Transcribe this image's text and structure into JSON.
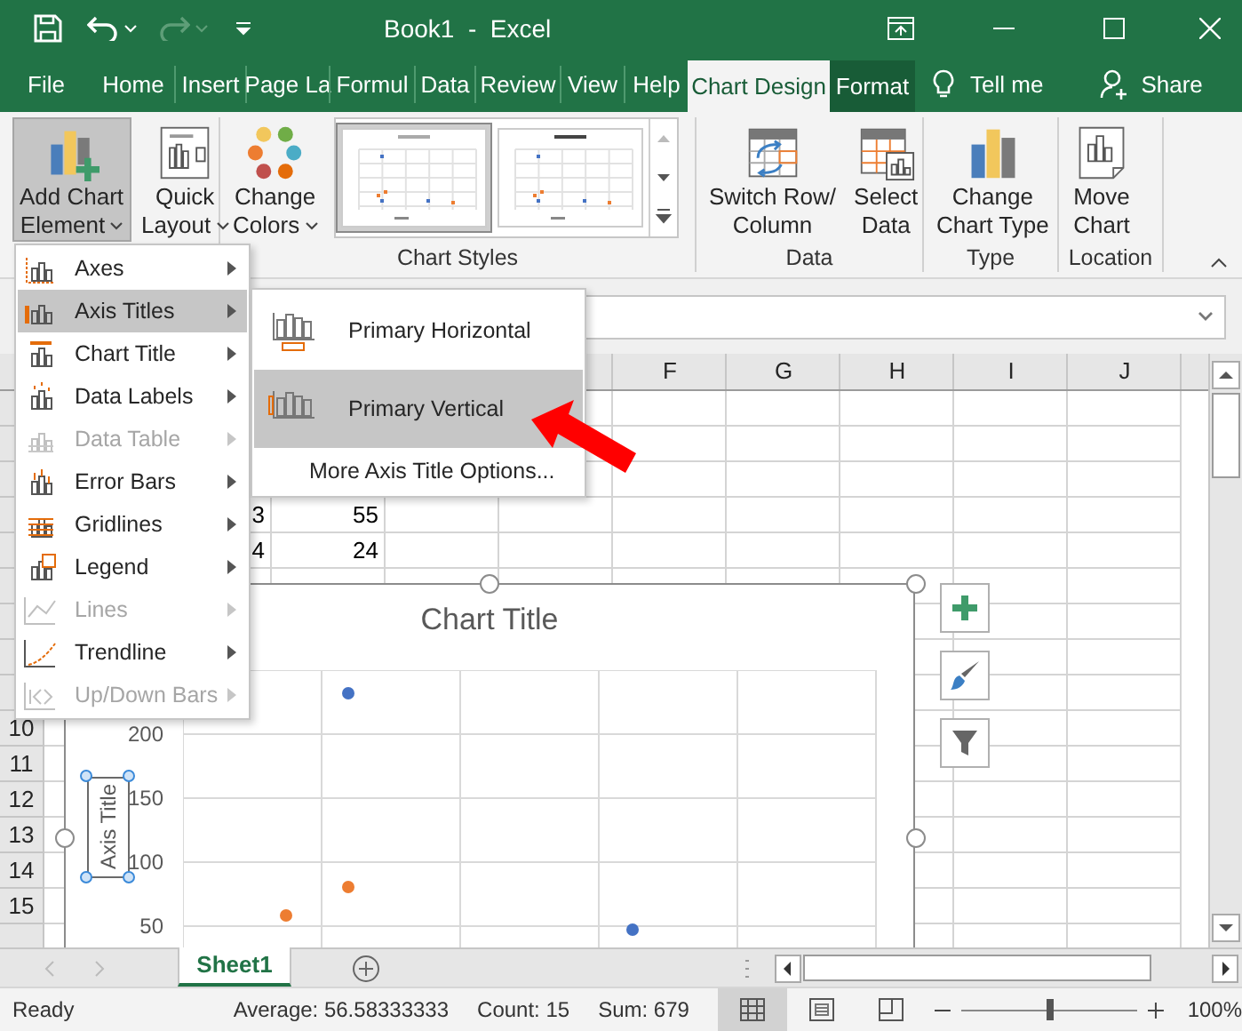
{
  "window": {
    "title": "Book1  -  Excel"
  },
  "ribbon_tabs": [
    {
      "label": "File",
      "selected": false,
      "contextual": false
    },
    {
      "label": "Home",
      "selected": false,
      "contextual": false
    },
    {
      "label": "Insert",
      "selected": false,
      "contextual": false
    },
    {
      "label": "Page La",
      "selected": false,
      "contextual": false
    },
    {
      "label": "Formul",
      "selected": false,
      "contextual": false
    },
    {
      "label": "Data",
      "selected": false,
      "contextual": false
    },
    {
      "label": "Review",
      "selected": false,
      "contextual": false
    },
    {
      "label": "View",
      "selected": false,
      "contextual": false
    },
    {
      "label": "Help",
      "selected": false,
      "contextual": false
    },
    {
      "label": "Chart Design",
      "selected": true,
      "contextual": true
    },
    {
      "label": "Format",
      "selected": false,
      "contextual": true
    }
  ],
  "tell_me": "Tell me",
  "share": "Share",
  "ribbon_groups": [
    {
      "kind": "layouts",
      "buttons": [
        {
          "lines": [
            "Add Chart",
            "Element"
          ],
          "dropdown": true,
          "pressed": true
        },
        {
          "lines": [
            "Quick",
            "Layout"
          ],
          "dropdown": true,
          "pressed": false
        }
      ]
    },
    {
      "kind": "styles",
      "label": "Chart Styles",
      "buttons": [
        {
          "lines": [
            "Change",
            "Colors"
          ],
          "dropdown": true,
          "pressed": false
        }
      ],
      "styles": [
        {
          "selected": true
        },
        {
          "selected": false
        }
      ]
    },
    {
      "kind": "plain",
      "label": "Data",
      "buttons": [
        {
          "lines": [
            "Switch Row/",
            "Column"
          ],
          "dropdown": false,
          "pressed": false
        },
        {
          "lines": [
            "Select",
            "Data"
          ],
          "dropdown": false,
          "pressed": false
        }
      ]
    },
    {
      "kind": "plain",
      "label": "Type",
      "buttons": [
        {
          "lines": [
            "Change",
            "Chart Type"
          ],
          "dropdown": false,
          "pressed": false
        }
      ]
    },
    {
      "kind": "plain",
      "label": "Location",
      "buttons": [
        {
          "lines": [
            "Move",
            "Chart"
          ],
          "dropdown": false,
          "pressed": false
        }
      ]
    }
  ],
  "chart_element_menu": [
    {
      "label": "Axes",
      "selected": false,
      "disabled": false
    },
    {
      "label": "Axis Titles",
      "selected": true,
      "disabled": false
    },
    {
      "label": "Chart Title",
      "selected": false,
      "disabled": false
    },
    {
      "label": "Data Labels",
      "selected": false,
      "disabled": false
    },
    {
      "label": "Data Table",
      "selected": false,
      "disabled": true
    },
    {
      "label": "Error Bars",
      "selected": false,
      "disabled": false
    },
    {
      "label": "Gridlines",
      "selected": false,
      "disabled": false
    },
    {
      "label": "Legend",
      "selected": false,
      "disabled": false
    },
    {
      "label": "Lines",
      "selected": false,
      "disabled": true
    },
    {
      "label": "Trendline",
      "selected": false,
      "disabled": false
    },
    {
      "label": "Up/Down Bars",
      "selected": false,
      "disabled": true
    }
  ],
  "axis_titles_submenu": [
    {
      "kind": "horizontal",
      "label": "Primary Horizontal",
      "selected": false
    },
    {
      "kind": "vertical",
      "label": "Primary Vertical",
      "selected": true
    },
    {
      "kind": "link",
      "label": "More Axis Title Options...",
      "selected": false
    }
  ],
  "columns": [
    "F",
    "G",
    "H",
    "I",
    "J"
  ],
  "row_numbers": [
    "10",
    "11",
    "12",
    "13",
    "14",
    "15"
  ],
  "cell_values": [
    "3",
    "55",
    "4",
    "24"
  ],
  "chart": {
    "title": "Chart Title",
    "axis_title": "Axis Title",
    "axis_title_selected": true,
    "y_axis_labels": [
      "200",
      "150",
      "100",
      "50"
    ]
  },
  "sheet_tabs": [
    {
      "label": "Sheet1",
      "selected": true
    }
  ],
  "status_bar": {
    "mode": "Ready",
    "average": "Average: 56.58333333",
    "count": "Count: 15",
    "sum": "Sum: 679",
    "views": [
      {
        "kind": "normal",
        "selected": true
      },
      {
        "kind": "page_layout",
        "selected": false
      },
      {
        "kind": "page_break",
        "selected": false
      }
    ],
    "zoom": {
      "level": 0.5,
      "reading": "100%"
    }
  }
}
